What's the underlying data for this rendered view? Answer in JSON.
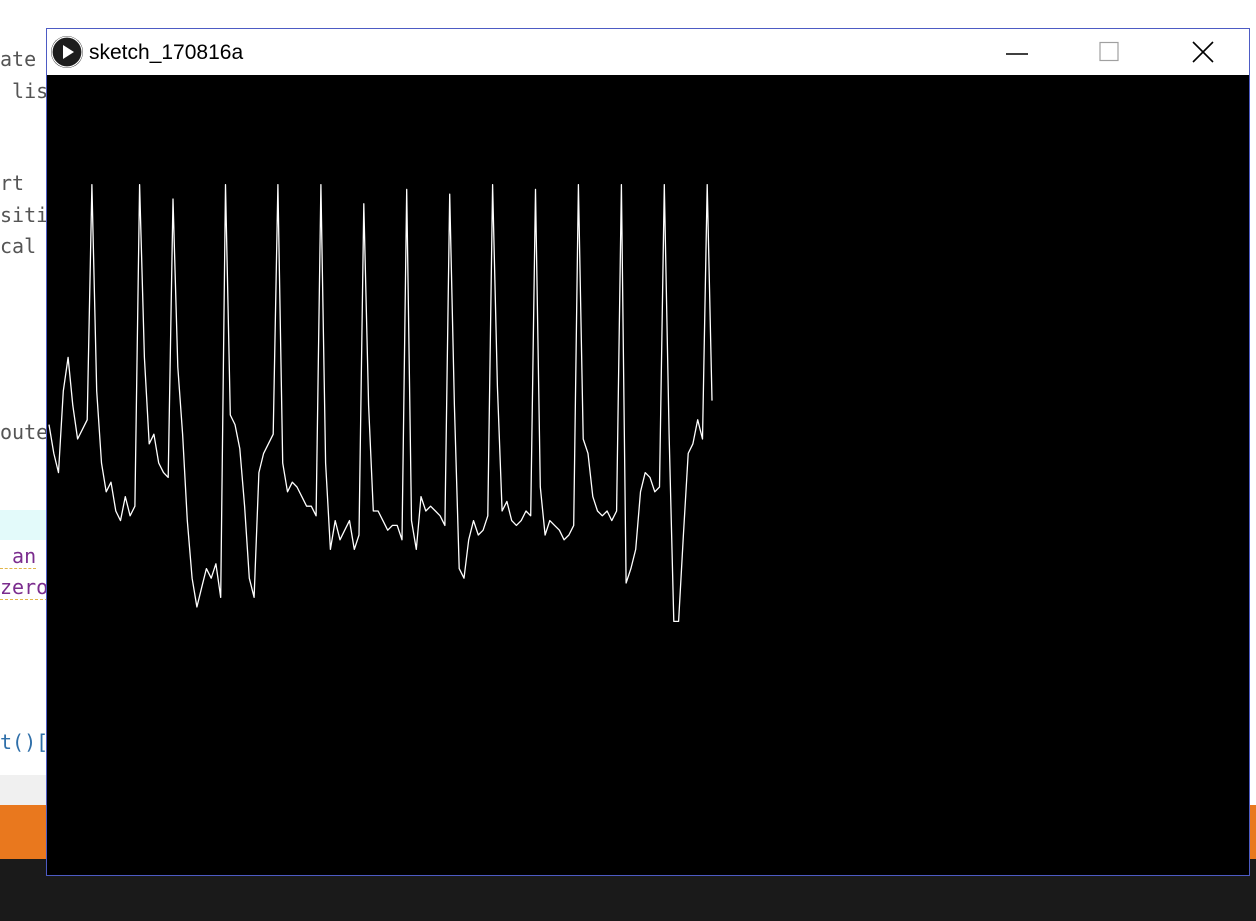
{
  "window": {
    "title": "sketch_170816a",
    "icon": "processing-play-icon",
    "buttons": {
      "minimize": "minimize-icon",
      "maximize": "maximize-icon",
      "close": "close-icon"
    },
    "border_color": "#4d5bc4"
  },
  "editor_fragments": [
    "ate",
    " lis",
    "rt",
    "siti",
    "cal",
    "oute",
    " an",
    "zero",
    "t()["
  ],
  "colors": {
    "canvas_background": "#000000",
    "signal_line": "#ffffff",
    "ide_orange": "#e9781e",
    "ide_dark": "#1a1a1a"
  },
  "signal": {
    "description_type": "line",
    "values": [
      0.48,
      0.42,
      0.38,
      0.55,
      0.62,
      0.52,
      0.45,
      0.47,
      0.49,
      0.98,
      0.55,
      0.4,
      0.34,
      0.36,
      0.3,
      0.28,
      0.33,
      0.29,
      0.31,
      0.98,
      0.62,
      0.44,
      0.46,
      0.4,
      0.38,
      0.37,
      0.95,
      0.6,
      0.46,
      0.28,
      0.16,
      0.1,
      0.14,
      0.18,
      0.16,
      0.19,
      0.12,
      0.98,
      0.5,
      0.48,
      0.43,
      0.31,
      0.16,
      0.12,
      0.38,
      0.42,
      0.44,
      0.46,
      0.98,
      0.4,
      0.34,
      0.36,
      0.35,
      0.33,
      0.31,
      0.31,
      0.29,
      0.98,
      0.4,
      0.22,
      0.28,
      0.24,
      0.26,
      0.28,
      0.22,
      0.25,
      0.94,
      0.52,
      0.3,
      0.3,
      0.28,
      0.26,
      0.27,
      0.27,
      0.24,
      0.97,
      0.28,
      0.22,
      0.33,
      0.3,
      0.31,
      0.3,
      0.29,
      0.27,
      0.96,
      0.52,
      0.18,
      0.16,
      0.24,
      0.28,
      0.25,
      0.26,
      0.29,
      0.98,
      0.56,
      0.3,
      0.32,
      0.28,
      0.27,
      0.28,
      0.3,
      0.29,
      0.97,
      0.35,
      0.25,
      0.28,
      0.27,
      0.26,
      0.24,
      0.25,
      0.27,
      0.98,
      0.45,
      0.42,
      0.33,
      0.3,
      0.29,
      0.3,
      0.28,
      0.3,
      0.98,
      0.15,
      0.18,
      0.22,
      0.34,
      0.38,
      0.37,
      0.34,
      0.35,
      0.98,
      0.46,
      0.07,
      0.07,
      0.25,
      0.42,
      0.44,
      0.49,
      0.45,
      0.98,
      0.53
    ]
  }
}
